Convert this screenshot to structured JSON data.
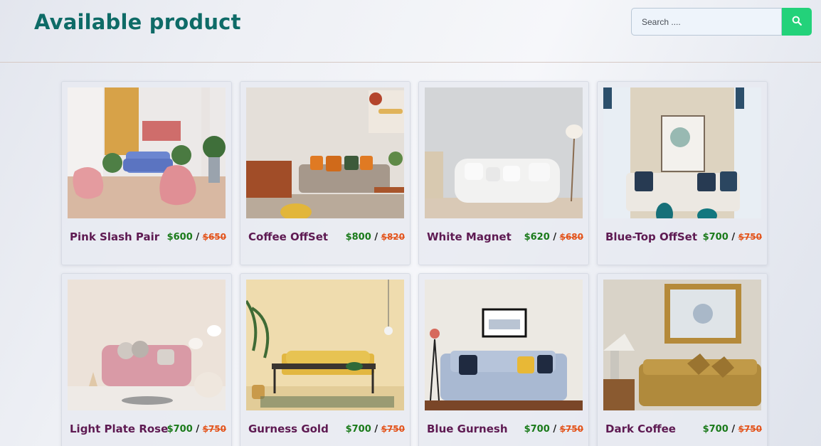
{
  "header": {
    "title": "Available product",
    "search_placeholder": "Search ....",
    "search_icon": "search-icon"
  },
  "colors": {
    "title": "#0e6b67",
    "product_name": "#5e1a52",
    "price": "#1a7a1a",
    "old_price": "#e3541c",
    "search_button": "#23d27a"
  },
  "products": [
    {
      "name": "Pink Slash Pair",
      "price": "$600",
      "separator": "/",
      "old_price": "$650"
    },
    {
      "name": "Coffee OffSet",
      "price": "$800",
      "separator": "/",
      "old_price": "$820"
    },
    {
      "name": "White Magnet",
      "price": "$620",
      "separator": "/",
      "old_price": "$680"
    },
    {
      "name": "Blue-Top OffSet",
      "price": "$700",
      "separator": "/",
      "old_price": "$750"
    },
    {
      "name": "Light Plate Rose",
      "price": "$700",
      "separator": "/",
      "old_price": "$750"
    },
    {
      "name": "Gurness Gold",
      "price": "$700",
      "separator": "/",
      "old_price": "$750"
    },
    {
      "name": "Blue Gurnesh",
      "price": "$700",
      "separator": "/",
      "old_price": "$750"
    },
    {
      "name": "Dark Coffee",
      "price": "$700",
      "separator": "/",
      "old_price": "$750"
    }
  ]
}
